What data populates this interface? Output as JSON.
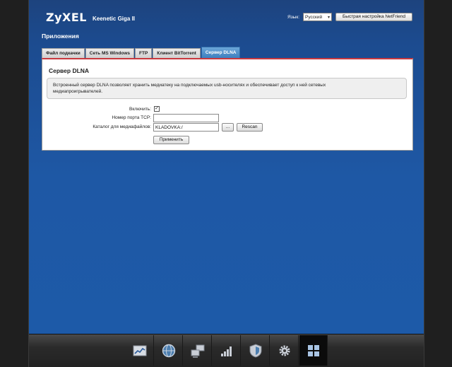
{
  "header": {
    "logo": "ZyXEL",
    "model": "Keenetic Giga II",
    "lang_label": "Язык:",
    "lang_value": "Русский",
    "wizard_button": "Быстрая настройка NetFriend"
  },
  "page_title": "Приложения",
  "tabs": [
    {
      "label": "Файл подкачки",
      "active": false
    },
    {
      "label": "Сеть MS Windows",
      "active": false
    },
    {
      "label": "FTP",
      "active": false
    },
    {
      "label": "Клиент BitTorrent",
      "active": false
    },
    {
      "label": "Сервер DLNA",
      "active": true
    }
  ],
  "panel": {
    "title": "Сервер DLNA",
    "info_line1": "Встроенный сервер DLNA позволяет хранить медиатеку на подключаемых usb-носителях и обеспечивает доступ к ней сетевых",
    "info_line2": "медиапроигрывателей.",
    "enable_label": "Включить:",
    "enable_checked_mark": "✓",
    "tcp_port_label": "Номер порта TCP:",
    "tcp_port_value": "",
    "media_dir_label": "Каталог для медиафайлов:",
    "media_dir_value": "KLADOVKA:/",
    "browse_button": "...",
    "rescan_button": "Rescan",
    "apply_button": "Применить"
  },
  "dock": {
    "items": [
      {
        "icon": "chart-icon",
        "active": false
      },
      {
        "icon": "globe-icon",
        "active": false
      },
      {
        "icon": "network-computers-icon",
        "active": false
      },
      {
        "icon": "signal-bars-icon",
        "active": false
      },
      {
        "icon": "shield-icon",
        "active": false
      },
      {
        "icon": "gear-icon",
        "active": false
      },
      {
        "icon": "apps-grid-icon",
        "active": true
      }
    ]
  },
  "colors": {
    "background_blue": "#1d5aa8",
    "tab_active": "#3d7fbf",
    "panel_accent_red": "#c9393f"
  }
}
